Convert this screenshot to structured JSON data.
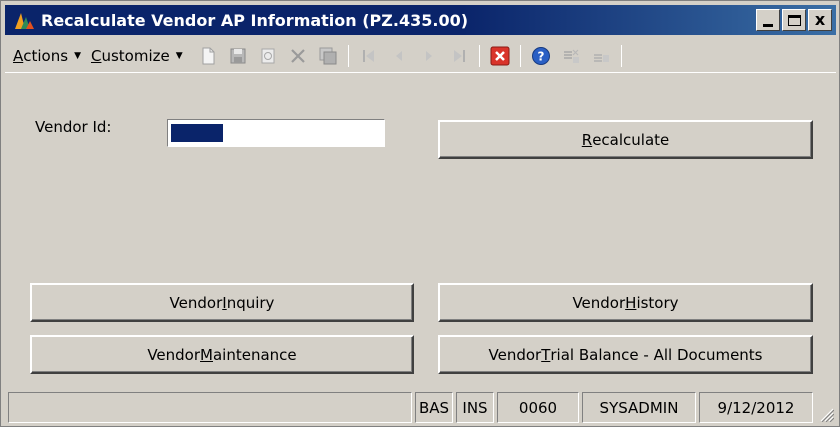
{
  "window": {
    "title": "Recalculate Vendor AP Information (PZ.435.00)",
    "close_glyph": "x"
  },
  "toolbar": {
    "actions_label": "ctions",
    "actions_accel": "A",
    "customize_label": "ustomize",
    "customize_accel": "C",
    "icons": [
      "new-icon",
      "save-icon",
      "refresh-icon",
      "delete-icon",
      "save-all-icon",
      "first-icon",
      "prev-icon",
      "next-icon",
      "last-icon",
      "cancel-close-icon",
      "help-icon",
      "note-icon",
      "note-add-icon"
    ]
  },
  "form": {
    "vendor_id_label": "Vendor Id:",
    "vendor_id_value": ""
  },
  "buttons": {
    "recalculate": {
      "pre": "",
      "accel": "R",
      "post": "ecalculate"
    },
    "vendor_inquiry": {
      "pre": "Vendor ",
      "accel": "I",
      "post": "nquiry"
    },
    "vendor_history": {
      "pre": "Vendor ",
      "accel": "H",
      "post": "istory"
    },
    "vendor_maintenance": {
      "pre": "Vendor ",
      "accel": "M",
      "post": "aintenance"
    },
    "vendor_trial_balance": {
      "pre": "Vendor ",
      "accel": "T",
      "post": "rial Balance - All Documents"
    }
  },
  "statusbar": {
    "message": "",
    "mode": "BAS",
    "insert": "INS",
    "company": "0060",
    "user": "SYSADMIN",
    "date": "9/12/2012"
  },
  "colors": {
    "titlebar": "#0a246a",
    "face": "#d4d0c8",
    "selection": "#0a246a",
    "close_red": "#d9342b"
  }
}
